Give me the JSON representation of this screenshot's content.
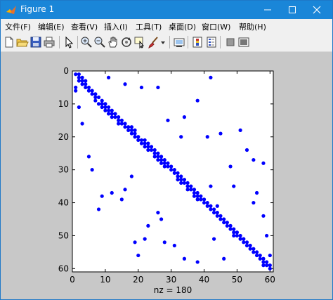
{
  "window": {
    "title": "Figure 1",
    "icon": "matlab-icon",
    "controls": [
      "minimize-icon",
      "maximize-icon",
      "close-icon"
    ]
  },
  "menubar": {
    "items": [
      "文件(F)",
      "编辑(E)",
      "查看(V)",
      "插入(I)",
      "工具(T)",
      "桌面(D)",
      "窗口(W)",
      "帮助(H)"
    ]
  },
  "toolbar": {
    "buttons": [
      "new-figure-icon",
      "open-file-icon",
      "save-figure-icon",
      "print-icon",
      "edit-plot-arrow-icon",
      "zoom-in-icon",
      "zoom-out-icon",
      "pan-hand-icon",
      "rotate-3d-icon",
      "data-cursor-icon",
      "brush-icon",
      "brush-dropdown-icon",
      "link-plot-icon",
      "insert-colorbar-icon",
      "insert-legend-icon",
      "hide-plot-tools-icon",
      "show-plot-tools-icon"
    ]
  },
  "colors": {
    "titlebar": "#1a86d8",
    "figure_bg": "#c8c8c8",
    "marker": "#0000ff"
  },
  "chart_data": {
    "type": "scatter",
    "title": "",
    "xlabel": "nz = 180",
    "ylabel": "",
    "xlim": [
      0,
      61
    ],
    "ylim": [
      0,
      61
    ],
    "y_reversed": true,
    "x_ticks": [
      "0",
      "10",
      "20",
      "30",
      "40",
      "50",
      "60"
    ],
    "y_ticks": [
      "0",
      "10",
      "20",
      "30",
      "40",
      "50",
      "60"
    ],
    "grid": false,
    "marker_color": "#0000ff",
    "points": [
      [
        1,
        1
      ],
      [
        2,
        1
      ],
      [
        2,
        2
      ],
      [
        3,
        2
      ],
      [
        2,
        3
      ],
      [
        3,
        3
      ],
      [
        4,
        3
      ],
      [
        3,
        4
      ],
      [
        4,
        4
      ],
      [
        4,
        5
      ],
      [
        5,
        5
      ],
      [
        1,
        5
      ],
      [
        1,
        6
      ],
      [
        5,
        6
      ],
      [
        6,
        6
      ],
      [
        6,
        7
      ],
      [
        7,
        7
      ],
      [
        7,
        8
      ],
      [
        8,
        8
      ],
      [
        7,
        9
      ],
      [
        9,
        9
      ],
      [
        8,
        10
      ],
      [
        9,
        10
      ],
      [
        10,
        10
      ],
      [
        9,
        11
      ],
      [
        10,
        11
      ],
      [
        11,
        11
      ],
      [
        10,
        12
      ],
      [
        11,
        12
      ],
      [
        12,
        12
      ],
      [
        11,
        13
      ],
      [
        12,
        13
      ],
      [
        13,
        13
      ],
      [
        12,
        14
      ],
      [
        13,
        14
      ],
      [
        14,
        14
      ],
      [
        14,
        15
      ],
      [
        15,
        15
      ],
      [
        14,
        16
      ],
      [
        15,
        16
      ],
      [
        16,
        16
      ],
      [
        16,
        17
      ],
      [
        17,
        17
      ],
      [
        18,
        17
      ],
      [
        17,
        18
      ],
      [
        18,
        18
      ],
      [
        19,
        18
      ],
      [
        18,
        19
      ],
      [
        19,
        19
      ],
      [
        19,
        20
      ],
      [
        20,
        20
      ],
      [
        20,
        21
      ],
      [
        21,
        21
      ],
      [
        22,
        21
      ],
      [
        21,
        22
      ],
      [
        22,
        22
      ],
      [
        23,
        22
      ],
      [
        22,
        23
      ],
      [
        23,
        23
      ],
      [
        24,
        23
      ],
      [
        23,
        24
      ],
      [
        24,
        24
      ],
      [
        25,
        24
      ],
      [
        25,
        25
      ],
      [
        26,
        25
      ],
      [
        25,
        26
      ],
      [
        26,
        26
      ],
      [
        27,
        26
      ],
      [
        26,
        27
      ],
      [
        27,
        27
      ],
      [
        28,
        27
      ],
      [
        27,
        28
      ],
      [
        28,
        28
      ],
      [
        29,
        28
      ],
      [
        28,
        29
      ],
      [
        29,
        29
      ],
      [
        30,
        29
      ],
      [
        30,
        30
      ],
      [
        31,
        30
      ],
      [
        31,
        31
      ],
      [
        32,
        31
      ],
      [
        32,
        32
      ],
      [
        33,
        32
      ],
      [
        32,
        33
      ],
      [
        33,
        33
      ],
      [
        34,
        33
      ],
      [
        33,
        34
      ],
      [
        34,
        34
      ],
      [
        35,
        34
      ],
      [
        35,
        35
      ],
      [
        36,
        35
      ],
      [
        35,
        36
      ],
      [
        36,
        36
      ],
      [
        37,
        36
      ],
      [
        37,
        37
      ],
      [
        38,
        37
      ],
      [
        37,
        38
      ],
      [
        38,
        38
      ],
      [
        39,
        38
      ],
      [
        38,
        39
      ],
      [
        39,
        39
      ],
      [
        40,
        39
      ],
      [
        40,
        40
      ],
      [
        41,
        40
      ],
      [
        41,
        41
      ],
      [
        42,
        41
      ],
      [
        42,
        42
      ],
      [
        43,
        42
      ],
      [
        43,
        43
      ],
      [
        44,
        43
      ],
      [
        44,
        44
      ],
      [
        45,
        44
      ],
      [
        45,
        45
      ],
      [
        46,
        45
      ],
      [
        46,
        46
      ],
      [
        47,
        46
      ],
      [
        47,
        47
      ],
      [
        48,
        47
      ],
      [
        48,
        48
      ],
      [
        49,
        48
      ],
      [
        49,
        49
      ],
      [
        50,
        49
      ],
      [
        49,
        50
      ],
      [
        50,
        50
      ],
      [
        51,
        50
      ],
      [
        51,
        51
      ],
      [
        52,
        51
      ],
      [
        52,
        52
      ],
      [
        53,
        52
      ],
      [
        53,
        53
      ],
      [
        54,
        53
      ],
      [
        54,
        54
      ],
      [
        55,
        54
      ],
      [
        55,
        55
      ],
      [
        56,
        55
      ],
      [
        56,
        56
      ],
      [
        57,
        56
      ],
      [
        57,
        57
      ],
      [
        58,
        57
      ],
      [
        58,
        58
      ],
      [
        59,
        58
      ],
      [
        58,
        59
      ],
      [
        59,
        59
      ],
      [
        60,
        59
      ],
      [
        60,
        60
      ],
      [
        2,
        11
      ],
      [
        3,
        16
      ],
      [
        5,
        26
      ],
      [
        6,
        30
      ],
      [
        8,
        42
      ],
      [
        9,
        38
      ],
      [
        11,
        2
      ],
      [
        16,
        4
      ],
      [
        21,
        5
      ],
      [
        26,
        5
      ],
      [
        38,
        9
      ],
      [
        42,
        2
      ],
      [
        34,
        14
      ],
      [
        29,
        15
      ],
      [
        33,
        20
      ],
      [
        41,
        20
      ],
      [
        45,
        19
      ],
      [
        48,
        29
      ],
      [
        49,
        35
      ],
      [
        51,
        18
      ],
      [
        53,
        24
      ],
      [
        55,
        27
      ],
      [
        58,
        28
      ],
      [
        56,
        37
      ],
      [
        55,
        40
      ],
      [
        58,
        44
      ],
      [
        59,
        50
      ],
      [
        60,
        56
      ],
      [
        38,
        58
      ],
      [
        34,
        57
      ],
      [
        31,
        53
      ],
      [
        28,
        52
      ],
      [
        27,
        45
      ],
      [
        26,
        43
      ],
      [
        23,
        47
      ],
      [
        22,
        51
      ],
      [
        19,
        52
      ],
      [
        18,
        32
      ],
      [
        16,
        36
      ],
      [
        15,
        39
      ],
      [
        12,
        37
      ],
      [
        44,
        41
      ],
      [
        42,
        35
      ],
      [
        46,
        57
      ],
      [
        43,
        51
      ],
      [
        20,
        56
      ]
    ]
  }
}
